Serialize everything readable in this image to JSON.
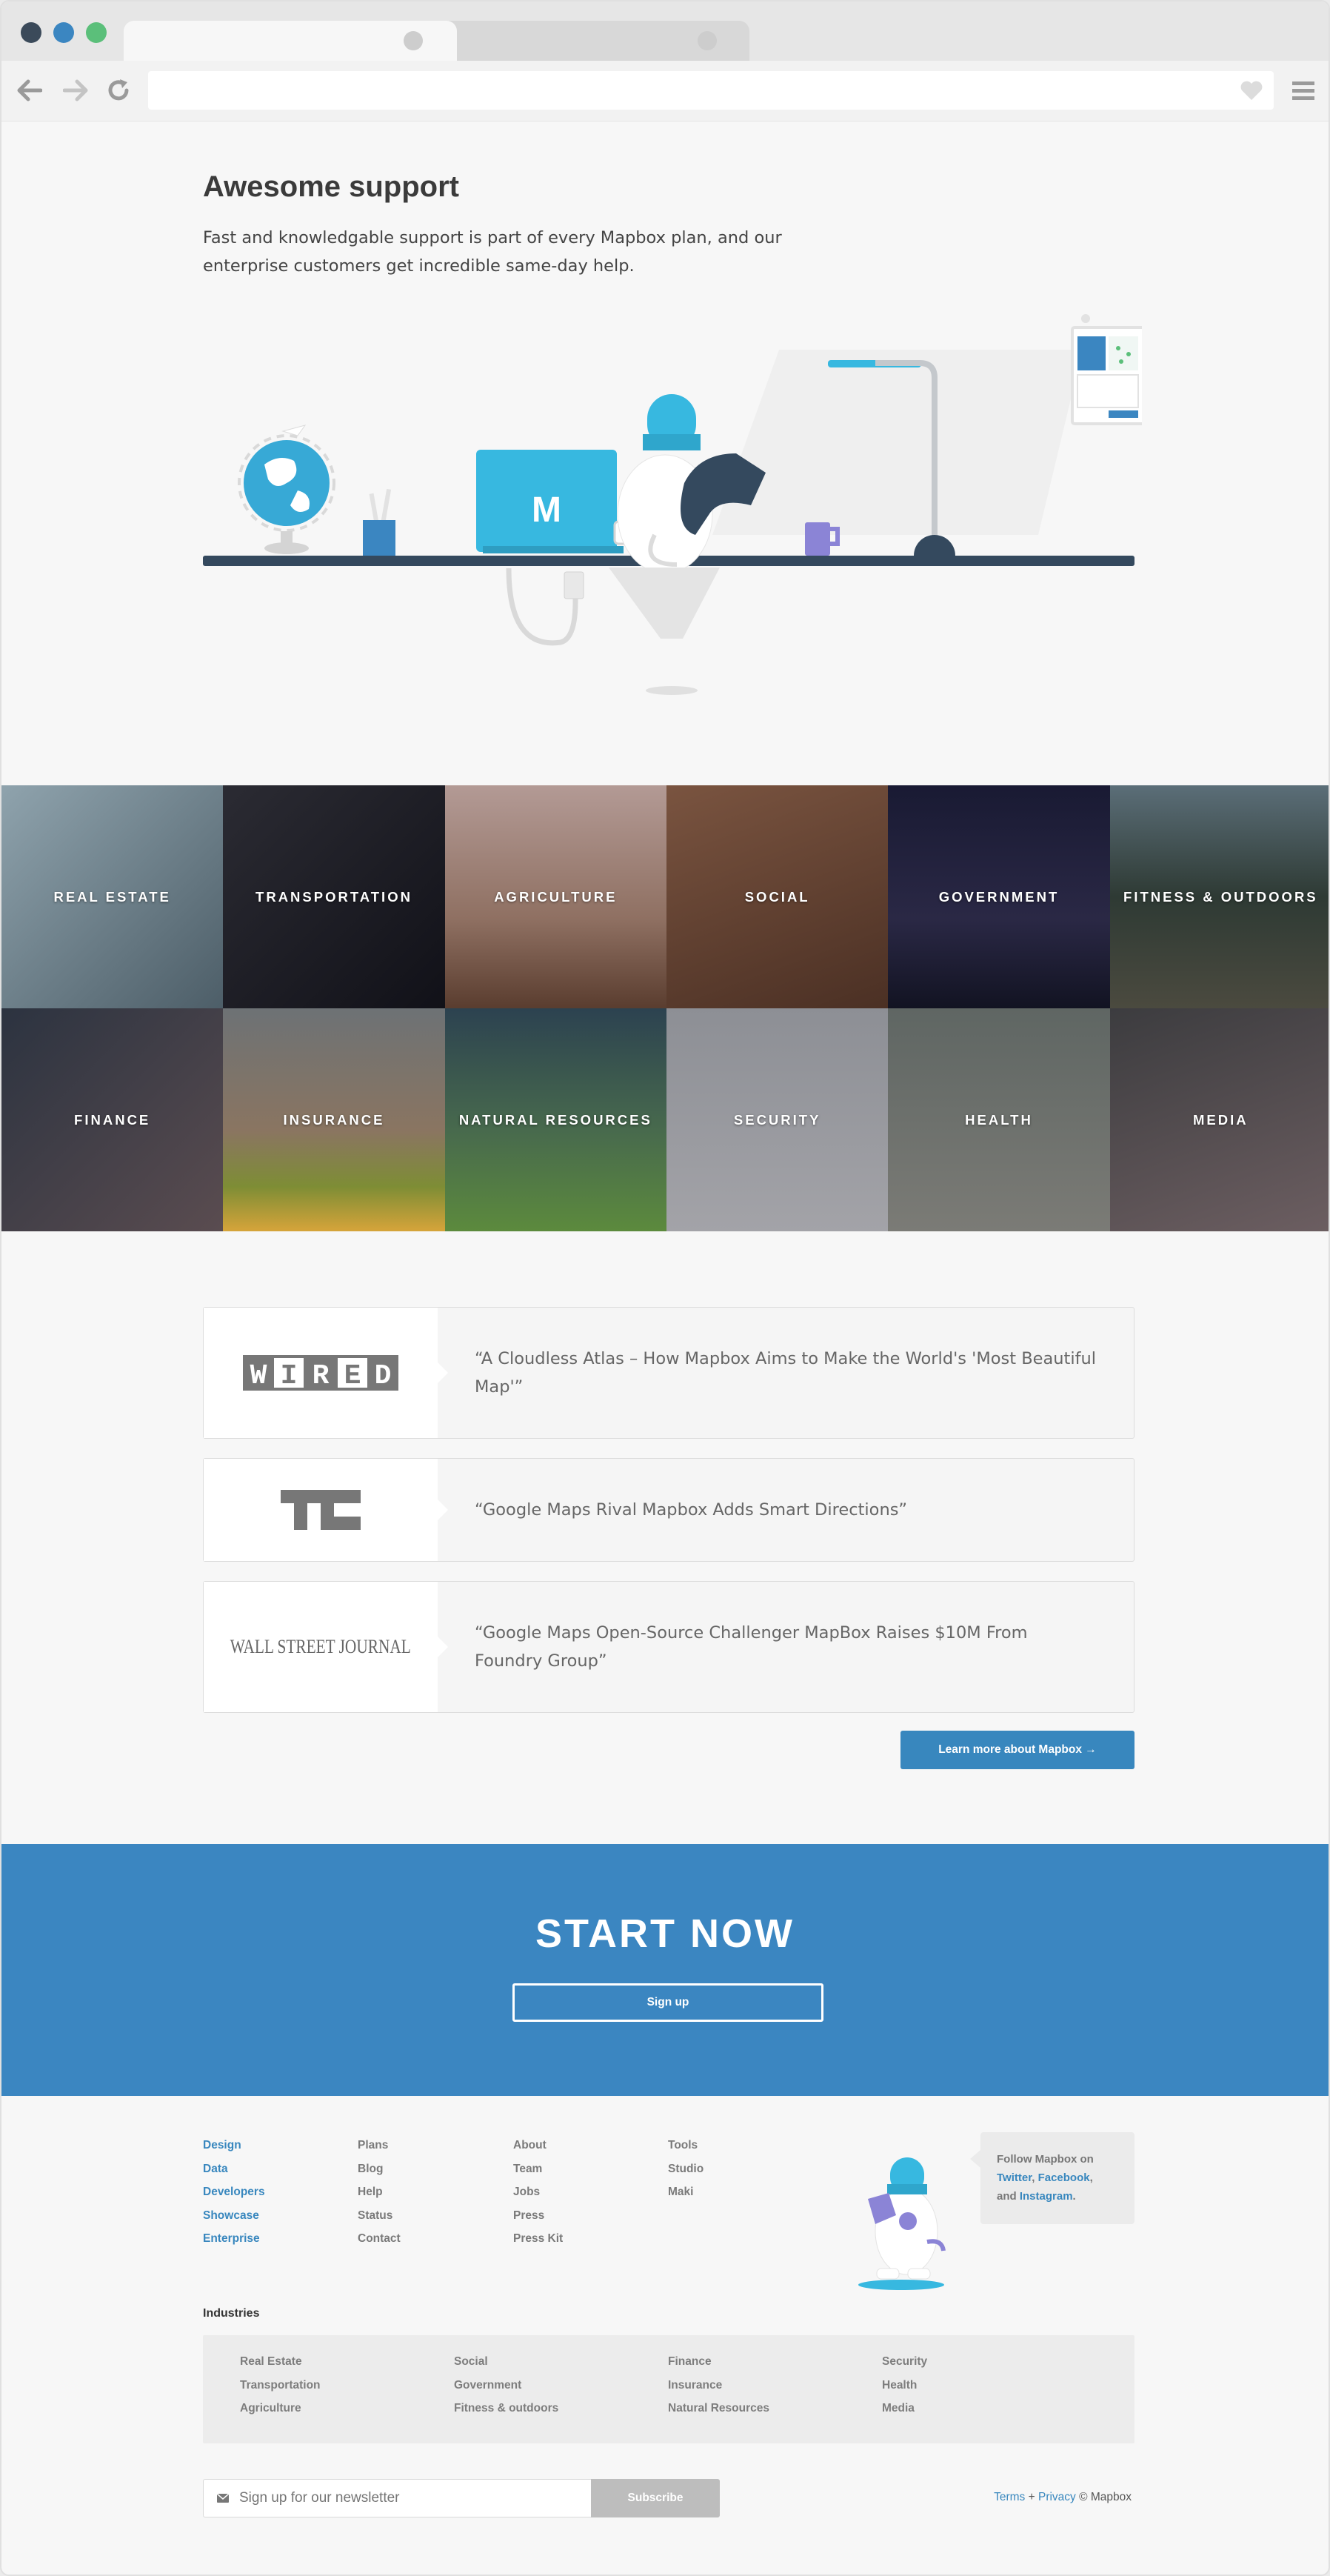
{
  "browser": {
    "window_dots": [
      "#3b4a5a",
      "#3b86c1",
      "#5bbf7a"
    ]
  },
  "hero": {
    "title": "Awesome support",
    "text": "Fast and knowledgable support is part of every Mapbox plan, and our enterprise customers get incredible same-day help.",
    "laptop_letter": "M"
  },
  "industries_grid": [
    {
      "label": "REAL ESTATE",
      "bg": "#6b7c86"
    },
    {
      "label": "TRANSPORTATION",
      "bg": "#1c1c22"
    },
    {
      "label": "AGRICULTURE",
      "bg": "#8a7168"
    },
    {
      "label": "SOCIAL",
      "bg": "#5b3f31"
    },
    {
      "label": "GOVERNMENT",
      "bg": "#1d1c30"
    },
    {
      "label": "FITNESS & OUTDOORS",
      "bg": "#3c4848"
    },
    {
      "label": "FINANCE",
      "bg": "#3d4452"
    },
    {
      "label": "INSURANCE",
      "bg": "#566062"
    },
    {
      "label": "NATURAL RESOURCES",
      "bg": "#3e5a3a"
    },
    {
      "label": "SECURITY",
      "bg": "#8d8c91"
    },
    {
      "label": "HEALTH",
      "bg": "#6e6f6c"
    },
    {
      "label": "MEDIA",
      "bg": "#4f4e50"
    }
  ],
  "press": [
    {
      "logo": "WIRED",
      "quote": "“A Cloudless Atlas – How Mapbox Aims to Make the World's 'Most Beautiful Map'”"
    },
    {
      "logo": "TC",
      "quote": "“Google Maps Rival Mapbox Adds Smart Directions”"
    },
    {
      "logo": "WALL STREET JOURNAL",
      "quote": "“Google Maps Open-Source Challenger MapBox Raises $10M From Foundry Group”"
    }
  ],
  "learn_more_label": "Learn more about Mapbox →",
  "cta": {
    "title": "START NOW",
    "button": "Sign up"
  },
  "footer": {
    "col1": [
      "Design",
      "Data",
      "Developers",
      "Showcase",
      "Enterprise"
    ],
    "col2": [
      "Plans",
      "Blog",
      "Help",
      "Status",
      "Contact"
    ],
    "col3": [
      "About",
      "Team",
      "Jobs",
      "Press",
      "Press Kit"
    ],
    "col4_head": "Tools",
    "col4": [
      "Studio",
      "Maki"
    ],
    "follow": {
      "prefix": "Follow Mapbox on",
      "twitter": "Twitter",
      "facebook": "Facebook",
      "and": "and",
      "instagram": "Instagram"
    },
    "industries_title": "Industries",
    "industries": [
      [
        "Real Estate",
        "Transportation",
        "Agriculture"
      ],
      [
        "Social",
        "Government",
        "Fitness & outdoors"
      ],
      [
        "Finance",
        "Insurance",
        "Natural Resources"
      ],
      [
        "Security",
        "Health",
        "Media"
      ]
    ],
    "newsletter_placeholder": "Sign up for our newsletter",
    "subscribe": "Subscribe",
    "terms": "Terms",
    "privacy": "Privacy",
    "copyright": "© Mapbox"
  }
}
